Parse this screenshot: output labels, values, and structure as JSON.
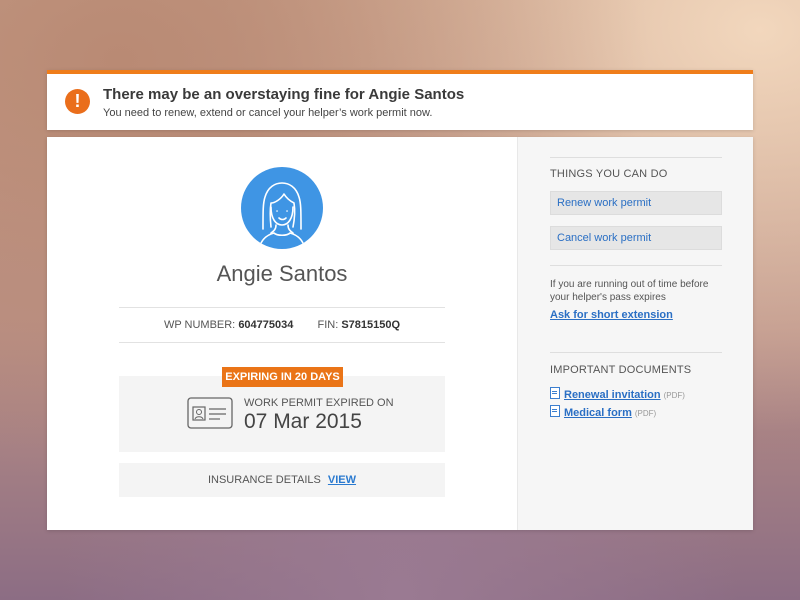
{
  "alert": {
    "icon": "exclamation-icon",
    "title": "There may be an overstaying fine for Angie Santos",
    "message": "You need to renew, extend or cancel your helper’s work permit now."
  },
  "profile": {
    "avatar": "female-avatar-icon",
    "name": "Angie Santos",
    "wp_label": "WP NUMBER:",
    "wp_number": "604775034",
    "fin_label": "FIN:",
    "fin_number": "S7815150Q"
  },
  "permit": {
    "badge": "EXPIRING IN 20 DAYS",
    "icon": "id-card-icon",
    "status_label": "WORK PERMIT EXPIRED ON",
    "date": "07 Mar 2015"
  },
  "insurance": {
    "label": "INSURANCE DETAILS",
    "link": "VIEW"
  },
  "sidebar": {
    "actions_heading": "THINGS YOU CAN DO",
    "actions": [
      {
        "label": "Renew work permit"
      },
      {
        "label": "Cancel work permit"
      }
    ],
    "note": "If you are running out of time before your helper's pass expires",
    "extension_link": "Ask for short extension",
    "documents_heading": "IMPORTANT DOCUMENTS",
    "documents": [
      {
        "label": "Renewal invitation",
        "format": "(PDF)",
        "icon": "document-icon"
      },
      {
        "label": "Medical form",
        "format": "(PDF)",
        "icon": "document-icon"
      }
    ]
  },
  "colors": {
    "accent_orange": "#ea7417",
    "link_blue": "#2a6fc4",
    "avatar_blue": "#3f95e4"
  }
}
